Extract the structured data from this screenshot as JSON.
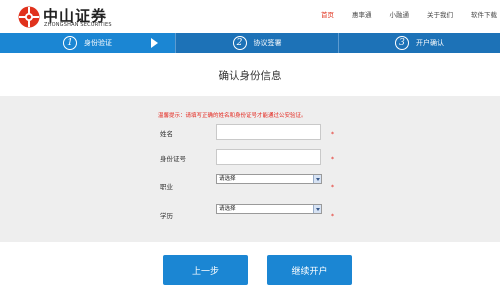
{
  "brand": {
    "name_cn": "中山证券",
    "name_en": "ZHONGSHAN SECURITIES",
    "logo_icon": "zhongshan-logo-icon",
    "accent_color": "#e0321d"
  },
  "nav": {
    "items": [
      {
        "label": "首页",
        "active": true
      },
      {
        "label": "惠率通",
        "active": false
      },
      {
        "label": "小融通",
        "active": false
      },
      {
        "label": "关于我们",
        "active": false
      },
      {
        "label": "软件下载",
        "active": false
      }
    ]
  },
  "steps": [
    {
      "num": "1",
      "label": "身份验证",
      "current": true
    },
    {
      "num": "2",
      "label": "协议签署",
      "current": false
    },
    {
      "num": "3",
      "label": "开户确认",
      "current": false
    }
  ],
  "steps_color": "#1d72b7",
  "page": {
    "title": "确认身份信息"
  },
  "form": {
    "notice": "温馨提示：请填写正确的姓名和身份证号才能通过公安验证。",
    "name_label": "姓名",
    "name_value": "",
    "id_label": "身份证号",
    "id_value": "",
    "job_label": "职业",
    "job_value": "请选择",
    "edu_label": "学历",
    "edu_value": "请选择",
    "required_mark": "*"
  },
  "buttons": {
    "prev": "上一步",
    "next": "继续开户"
  }
}
